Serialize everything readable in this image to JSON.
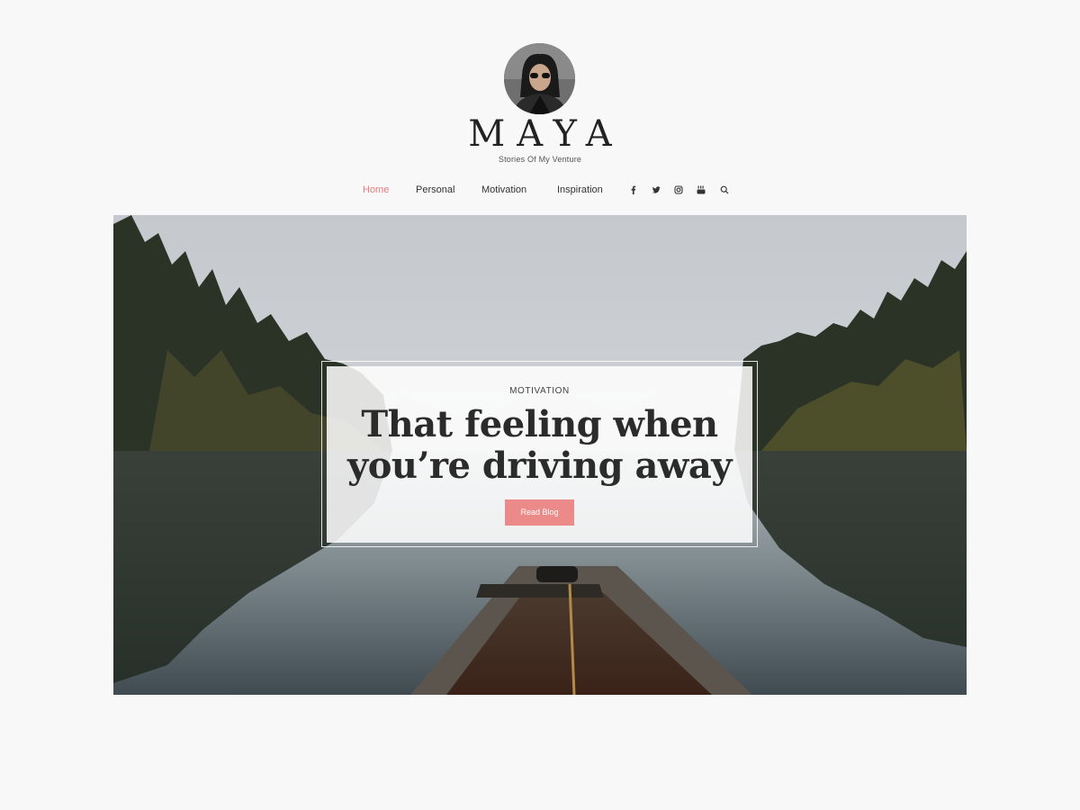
{
  "site": {
    "title": "MAYA",
    "tagline": "Stories Of My Venture"
  },
  "nav": {
    "items": [
      {
        "label": "Home",
        "active": true
      },
      {
        "label": "Personal",
        "active": false
      },
      {
        "label": "Motivation",
        "active": false
      },
      {
        "label": "Inspiration",
        "active": false
      }
    ],
    "icons": [
      "facebook-icon",
      "twitter-icon",
      "instagram-icon",
      "youtube-icon",
      "search-icon"
    ]
  },
  "hero": {
    "category": "MOTIVATION",
    "title": "That feeling when you’re driving away",
    "button_label": "Read Blog"
  },
  "colors": {
    "accent": "#ec8a8a",
    "nav_active": "#e87b7b",
    "background": "#f8f8f8",
    "text": "#222222"
  }
}
